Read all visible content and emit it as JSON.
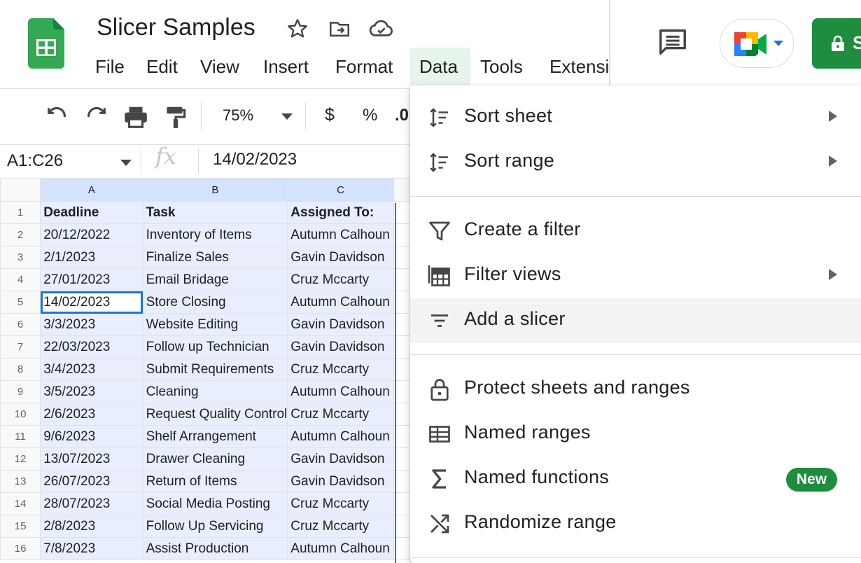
{
  "doc": {
    "title": "Slicer Samples"
  },
  "menubar": [
    "File",
    "Edit",
    "View",
    "Insert",
    "Format",
    "Data",
    "Tools",
    "Extensi"
  ],
  "toolbar": {
    "zoom": "75%",
    "currency": "$",
    "percent": "%",
    "decimal_partial": ".0"
  },
  "formula_bar": {
    "name_box": "A1:C26",
    "fx": "fx",
    "value": "14/02/2023"
  },
  "sheet": {
    "columns": [
      "A",
      "B",
      "C"
    ],
    "rows": [
      {
        "n": "1",
        "cells": [
          "Deadline",
          "Task",
          "Assigned To:"
        ]
      },
      {
        "n": "2",
        "cells": [
          "20/12/2022",
          "Inventory of Items",
          "Autumn Calhoun"
        ]
      },
      {
        "n": "3",
        "cells": [
          "2/1/2023",
          "Finalize Sales",
          "Gavin Davidson"
        ]
      },
      {
        "n": "4",
        "cells": [
          "27/01/2023",
          "Email Bridage",
          "Cruz Mccarty"
        ]
      },
      {
        "n": "5",
        "cells": [
          "14/02/2023",
          "Store Closing",
          "Autumn Calhoun"
        ]
      },
      {
        "n": "6",
        "cells": [
          "3/3/2023",
          "Website Editing",
          "Gavin Davidson"
        ]
      },
      {
        "n": "7",
        "cells": [
          "22/03/2023",
          "Follow up Technician",
          "Gavin Davidson"
        ]
      },
      {
        "n": "8",
        "cells": [
          "3/4/2023",
          "Submit Requirements",
          "Cruz Mccarty"
        ]
      },
      {
        "n": "9",
        "cells": [
          "3/5/2023",
          "Cleaning",
          "Autumn Calhoun"
        ]
      },
      {
        "n": "10",
        "cells": [
          "2/6/2023",
          "Request Quality Control",
          "Cruz Mccarty"
        ]
      },
      {
        "n": "11",
        "cells": [
          "9/6/2023",
          "Shelf Arrangement",
          "Autumn Calhoun"
        ]
      },
      {
        "n": "12",
        "cells": [
          "13/07/2023",
          "Drawer Cleaning",
          "Gavin Davidson"
        ]
      },
      {
        "n": "13",
        "cells": [
          "26/07/2023",
          "Return of Items",
          "Gavin Davidson"
        ]
      },
      {
        "n": "14",
        "cells": [
          "28/07/2023",
          "Social Media Posting",
          "Cruz Mccarty"
        ]
      },
      {
        "n": "15",
        "cells": [
          "2/8/2023",
          "Follow Up Servicing",
          "Cruz Mccarty"
        ]
      },
      {
        "n": "16",
        "cells": [
          "7/8/2023",
          "Assist Production",
          "Autumn Calhoun"
        ]
      }
    ]
  },
  "data_menu": [
    {
      "label": "Sort sheet",
      "icon": "sort-icon",
      "submenu": true
    },
    {
      "label": "Sort range",
      "icon": "sort-icon",
      "submenu": true
    },
    {
      "label": "Create a filter",
      "icon": "filter-icon",
      "submenu": false
    },
    {
      "label": "Filter views",
      "icon": "filter-views-icon",
      "submenu": true
    },
    {
      "label": "Add a slicer",
      "icon": "slicer-icon",
      "submenu": false,
      "highlighted": true
    },
    {
      "label": "Protect sheets and ranges",
      "icon": "lock-icon",
      "submenu": false
    },
    {
      "label": "Named ranges",
      "icon": "named-ranges-icon",
      "submenu": false
    },
    {
      "label": "Named functions",
      "icon": "sigma-icon",
      "submenu": false,
      "badge": "New"
    },
    {
      "label": "Randomize range",
      "icon": "shuffle-icon",
      "submenu": false
    }
  ],
  "colors": {
    "brand_green": "#1e8e3e",
    "selection": "#1a73e8",
    "menu_highlight": "#e6f4ea"
  }
}
